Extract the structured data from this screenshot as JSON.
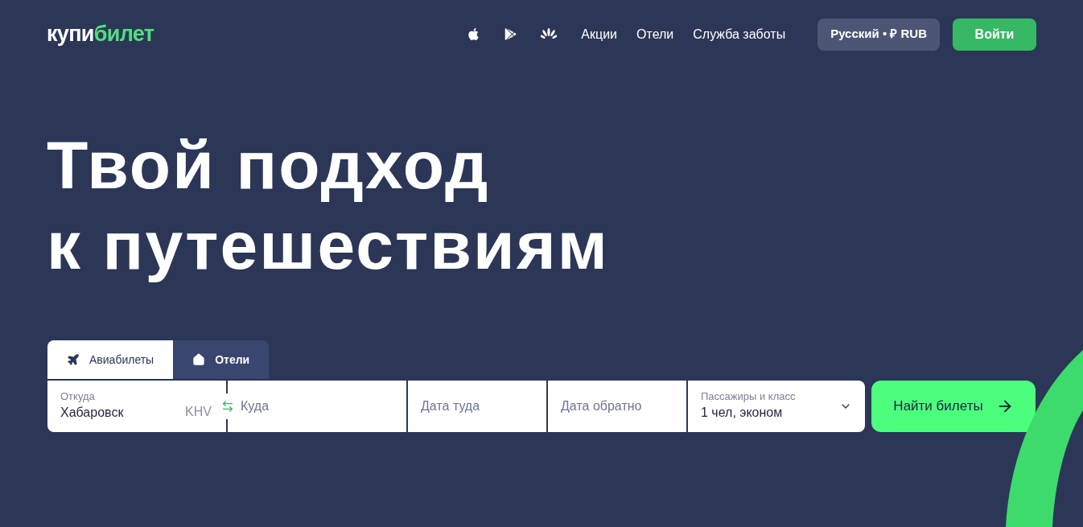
{
  "header": {
    "logo": [
      "купи",
      "билет"
    ],
    "nav": [
      "Акции",
      "Отели",
      "Служба заботы"
    ],
    "language_button": "Русский • ₽ RUB",
    "login_button": "Войти"
  },
  "hero": {
    "title_lines": [
      "Твой подход",
      "к путешествиям"
    ]
  },
  "search": {
    "tabs": [
      {
        "label": "Авиабилеты",
        "kind": "flights",
        "selected": true
      },
      {
        "label": "Отели",
        "kind": "hotels",
        "selected": false
      }
    ],
    "fields": [
      {
        "kind": "value",
        "label": "Откуда",
        "value": "Хабаровск",
        "code": "KHV"
      },
      {
        "kind": "placeholder",
        "placeholder": "Куда"
      },
      {
        "kind": "placeholder",
        "placeholder": "Дата туда"
      },
      {
        "kind": "placeholder",
        "placeholder": "Дата обратно"
      },
      {
        "kind": "select",
        "label": "Пассажиры и класс",
        "value": "1 чел, эконом"
      }
    ],
    "submit": "Найти билеты"
  }
}
